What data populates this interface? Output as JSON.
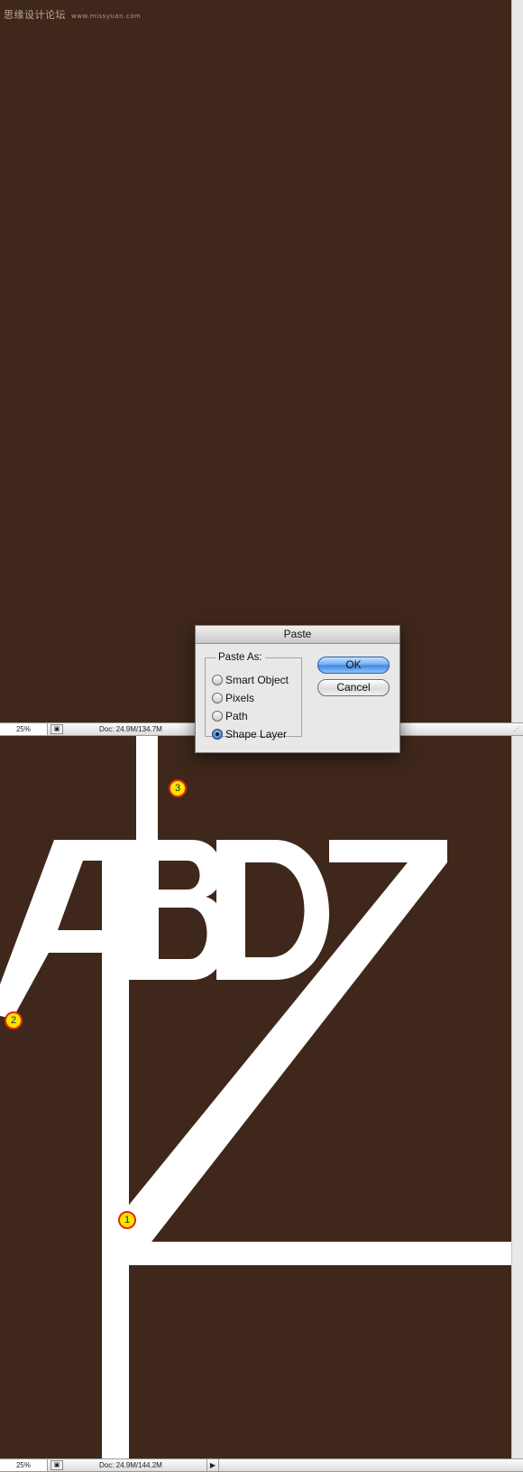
{
  "watermark": {
    "text": "思缘设计论坛",
    "site": "www.missyuan.com"
  },
  "colors": {
    "canvas_background": "#3f281b",
    "letter_fill": "#ffffff",
    "marker_fill": "#ffe600",
    "marker_border": "#e32a12"
  },
  "status_bar_top": {
    "zoom": "25%",
    "doc": "Doc: 24.9M/134.7M"
  },
  "status_bar_bottom": {
    "zoom": "25%",
    "doc": "Doc: 24.9M/144.2M"
  },
  "icons": {
    "info": "document-info-icon",
    "arrow": "triangle-right-icon",
    "grip": "resize-grip-icon"
  },
  "artwork": {
    "letters": "ABDZ"
  },
  "markers": [
    {
      "label": "3"
    },
    {
      "label": "2"
    },
    {
      "label": "1"
    }
  ],
  "dialog": {
    "title": "Paste",
    "group_label": "Paste As:",
    "options": [
      {
        "label": "Smart Object",
        "selected": false
      },
      {
        "label": "Pixels",
        "selected": false
      },
      {
        "label": "Path",
        "selected": false
      },
      {
        "label": "Shape Layer",
        "selected": true
      }
    ],
    "ok_label": "OK",
    "cancel_label": "Cancel"
  }
}
